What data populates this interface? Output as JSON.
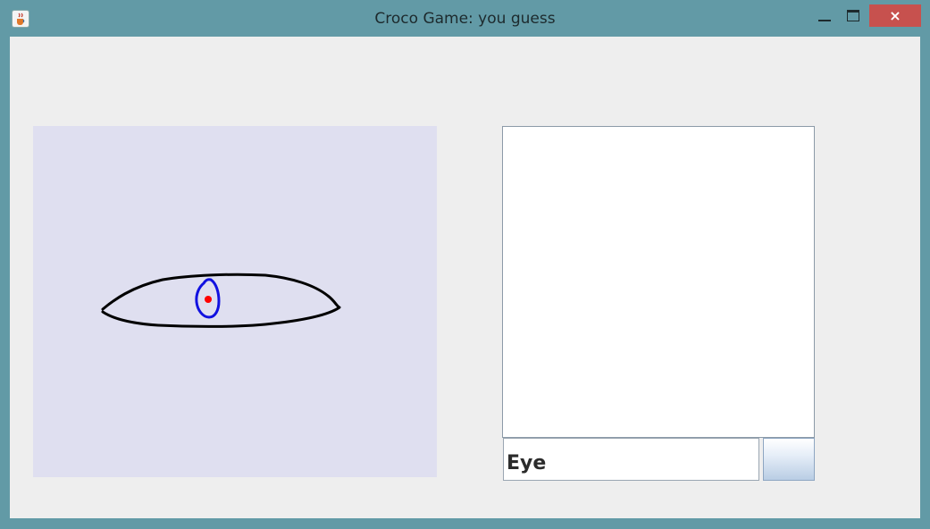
{
  "window": {
    "title": "Croco Game: you guess",
    "icon": "java-cup-icon",
    "controls": {
      "minimize": "minimize-icon",
      "maximize": "maximize-icon",
      "close": "×"
    }
  },
  "canvas": {
    "background": "#dfdff0",
    "strokes": [
      {
        "color": "#000000",
        "shape": "eye-outline"
      },
      {
        "color": "#0000ff",
        "shape": "iris"
      },
      {
        "color": "#ff0000",
        "shape": "pupil"
      }
    ]
  },
  "chat": {
    "messages": []
  },
  "guess": {
    "value": "Eye"
  },
  "send": {
    "label": ""
  }
}
